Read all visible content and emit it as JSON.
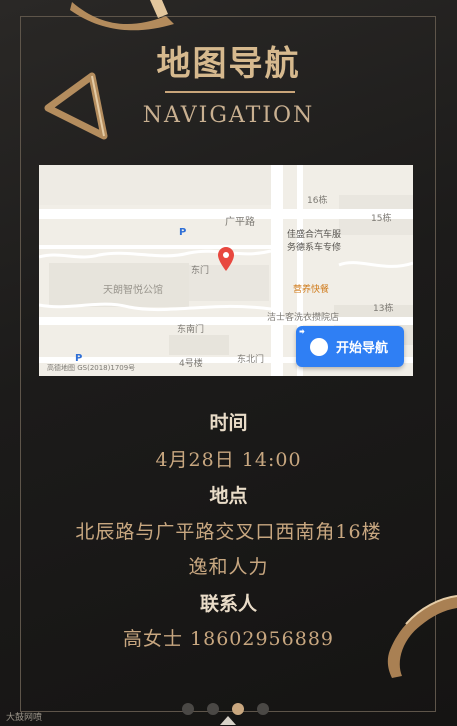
{
  "header": {
    "title": "地图导航",
    "subtitle": "NAVIGATION"
  },
  "map": {
    "labels": {
      "road1": "广平路",
      "company": "佳盛合汽车服",
      "company2": "务德系车专修",
      "food": "营养快餐",
      "laundry": "洁士客洗衣攒院店",
      "apartment": "天朗智悦公馆",
      "gate_east": "东门",
      "gate_se": "东南门",
      "gate_ne": "东北门",
      "building4": "4号楼",
      "building13": "13栋",
      "building15": "15栋",
      "building16": "16栋",
      "copyright": "高德地图 GS(2018)1709号"
    },
    "nav_button": "开始导航"
  },
  "details": {
    "time_label": "时间",
    "time_value": "4月28日 14:00",
    "place_label": "地点",
    "place_value_1": "北辰路与广平路交叉口西南角16楼",
    "place_value_2": "逸和人力",
    "contact_label": "联系人",
    "contact_value": "高女士 18602956889"
  },
  "pagination": {
    "total": 4,
    "active": 3
  },
  "watermark": "大鼓网喷",
  "colors": {
    "gold": "#c9a77f",
    "bg": "#1c1b1a",
    "nav_blue": "#2f7ff4"
  }
}
